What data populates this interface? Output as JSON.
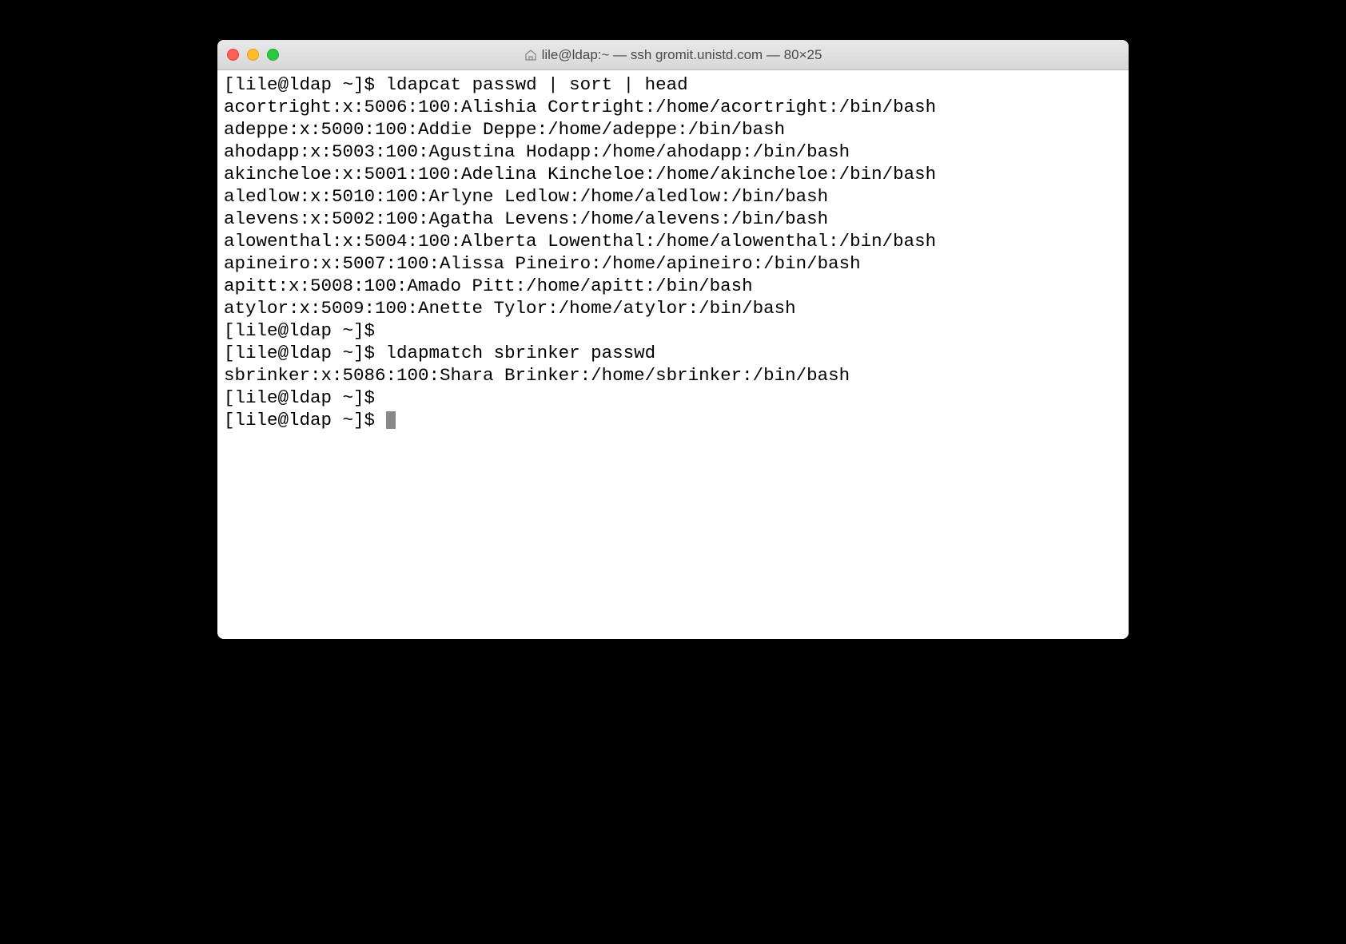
{
  "window": {
    "title": "lile@ldap:~ — ssh gromit.unistd.com — 80×25"
  },
  "terminal": {
    "lines": [
      {
        "type": "prompt",
        "prompt": "[lile@ldap ~]$ ",
        "command": "ldapcat passwd | sort | head"
      },
      {
        "type": "output",
        "text": "acortright:x:5006:100:Alishia Cortright:/home/acortright:/bin/bash"
      },
      {
        "type": "output",
        "text": "adeppe:x:5000:100:Addie Deppe:/home/adeppe:/bin/bash"
      },
      {
        "type": "output",
        "text": "ahodapp:x:5003:100:Agustina Hodapp:/home/ahodapp:/bin/bash"
      },
      {
        "type": "output",
        "text": "akincheloe:x:5001:100:Adelina Kincheloe:/home/akincheloe:/bin/bash"
      },
      {
        "type": "output",
        "text": "aledlow:x:5010:100:Arlyne Ledlow:/home/aledlow:/bin/bash"
      },
      {
        "type": "output",
        "text": "alevens:x:5002:100:Agatha Levens:/home/alevens:/bin/bash"
      },
      {
        "type": "output",
        "text": "alowenthal:x:5004:100:Alberta Lowenthal:/home/alowenthal:/bin/bash"
      },
      {
        "type": "output",
        "text": "apineiro:x:5007:100:Alissa Pineiro:/home/apineiro:/bin/bash"
      },
      {
        "type": "output",
        "text": "apitt:x:5008:100:Amado Pitt:/home/apitt:/bin/bash"
      },
      {
        "type": "output",
        "text": "atylor:x:5009:100:Anette Tylor:/home/atylor:/bin/bash"
      },
      {
        "type": "prompt",
        "prompt": "[lile@ldap ~]$ ",
        "command": ""
      },
      {
        "type": "prompt",
        "prompt": "[lile@ldap ~]$ ",
        "command": "ldapmatch sbrinker passwd"
      },
      {
        "type": "output",
        "text": "sbrinker:x:5086:100:Shara Brinker:/home/sbrinker:/bin/bash"
      },
      {
        "type": "prompt",
        "prompt": "[lile@ldap ~]$ ",
        "command": ""
      },
      {
        "type": "prompt",
        "prompt": "[lile@ldap ~]$ ",
        "command": "",
        "cursor": true
      }
    ]
  }
}
